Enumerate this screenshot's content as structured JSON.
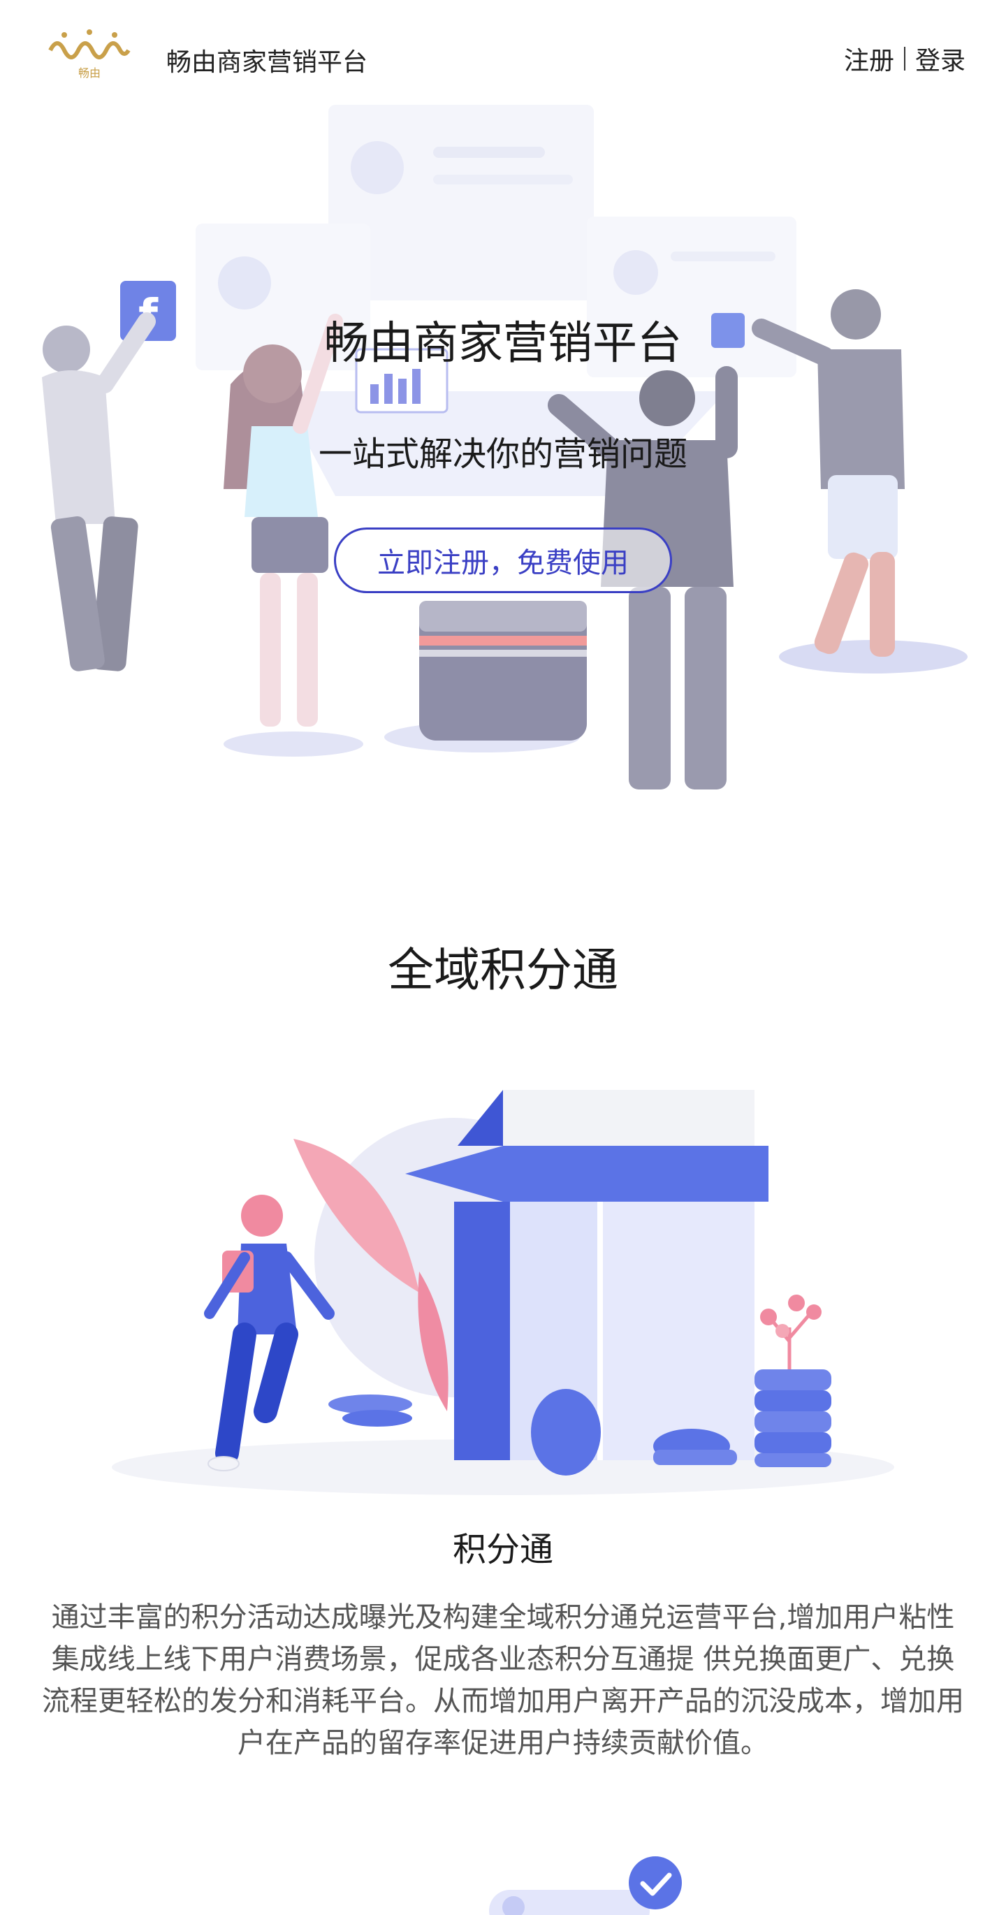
{
  "header": {
    "logo_text": "畅由",
    "brand_name": "畅由商家营销平台",
    "register_label": "注册",
    "login_label": "登录"
  },
  "hero": {
    "title": "畅由商家营销平台",
    "subtitle": "一站式解决你的营销问题",
    "cta_label": "立即注册，免费使用"
  },
  "section": {
    "title": "全域积分通"
  },
  "card": {
    "title": "积分通",
    "description": "通过丰富的积分活动达成曝光及构建全域积分通兑运营平台,增加用户粘性集成线上线下用户消费场景，促成各业态积分互通提 供兑换面更广、兑换流程更轻松的发分和消耗平台。从而增加用户离开产品的沉没成本，增加用户在产品的留存率促进用户持续贡献价值。"
  },
  "colors": {
    "accent": "#3a3fc4",
    "logo_gold": "#c9a04a",
    "illus_blue": "#5b6fe0",
    "illus_pink": "#f08aa0"
  }
}
